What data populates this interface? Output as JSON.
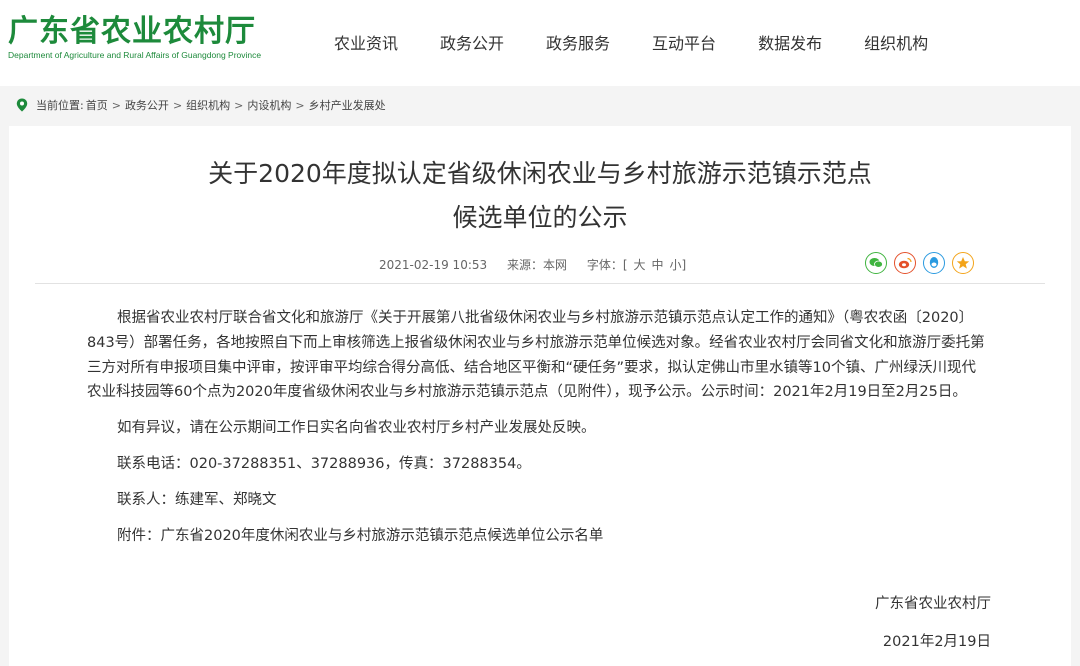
{
  "header": {
    "logo_title": "广东省农业农村厅",
    "logo_subtitle": "Department of Agriculture and Rural Affairs of Guangdong Province",
    "nav": [
      {
        "label": "农业资讯"
      },
      {
        "label": "政务公开"
      },
      {
        "label": "政务服务"
      },
      {
        "label": "互动平台"
      },
      {
        "label": "数据发布"
      },
      {
        "label": "组织机构"
      }
    ]
  },
  "breadcrumb": {
    "label": "当前位置:",
    "items": [
      "首页",
      "政务公开",
      "组织机构",
      "内设机构",
      "乡村产业发展处"
    ],
    "separator": ">"
  },
  "article": {
    "title_line1": "关于2020年度拟认定省级休闲农业与乡村旅游示范镇示范点",
    "title_line2": "候选单位的公示",
    "date": "2021-02-19 10:53",
    "source": "来源：本网",
    "font_label": "字体：[",
    "font_large": "大",
    "font_medium": "中",
    "font_small": "小",
    "font_close": "]",
    "paragraphs": [
      "根据省农业农村厅联合省文化和旅游厅《关于开展第八批省级休闲农业与乡村旅游示范镇示范点认定工作的通知》（粤农农函〔2020〕843号）部署任务，各地按照自下而上审核筛选上报省级休闲农业与乡村旅游示范单位候选对象。经省农业农村厅会同省文化和旅游厅委托第三方对所有申报项目集中评审，按评审平均综合得分高低、结合地区平衡和“硬任务”要求，拟认定佛山市里水镇等10个镇、广州绿沃川现代农业科技园等60个点为2020年度省级休闲农业与乡村旅游示范镇示范点（见附件），现予公示。公示时间：2021年2月19日至2月25日。",
      "如有异议，请在公示期间工作日实名向省农业农村厅乡村产业发展处反映。",
      "联系电话：020-37288351、37288936，传真：37288354。",
      "联系人：练建军、郑晓文",
      "附件：广东省2020年度休闲农业与乡村旅游示范镇示范点候选单位公示名单"
    ],
    "signature": "广东省农业农村厅",
    "sign_date": "2021年2月19日"
  },
  "share": [
    {
      "icon": "wechat-icon",
      "color": "#3fb43f"
    },
    {
      "icon": "weibo-icon",
      "color": "#e4502a"
    },
    {
      "icon": "qq-icon",
      "color": "#2a9ae0"
    },
    {
      "icon": "qzone-icon",
      "color": "#f3a41a"
    }
  ],
  "colors": {
    "brand_green": "#1d8a3b",
    "page_bg": "#f4f4f4"
  }
}
